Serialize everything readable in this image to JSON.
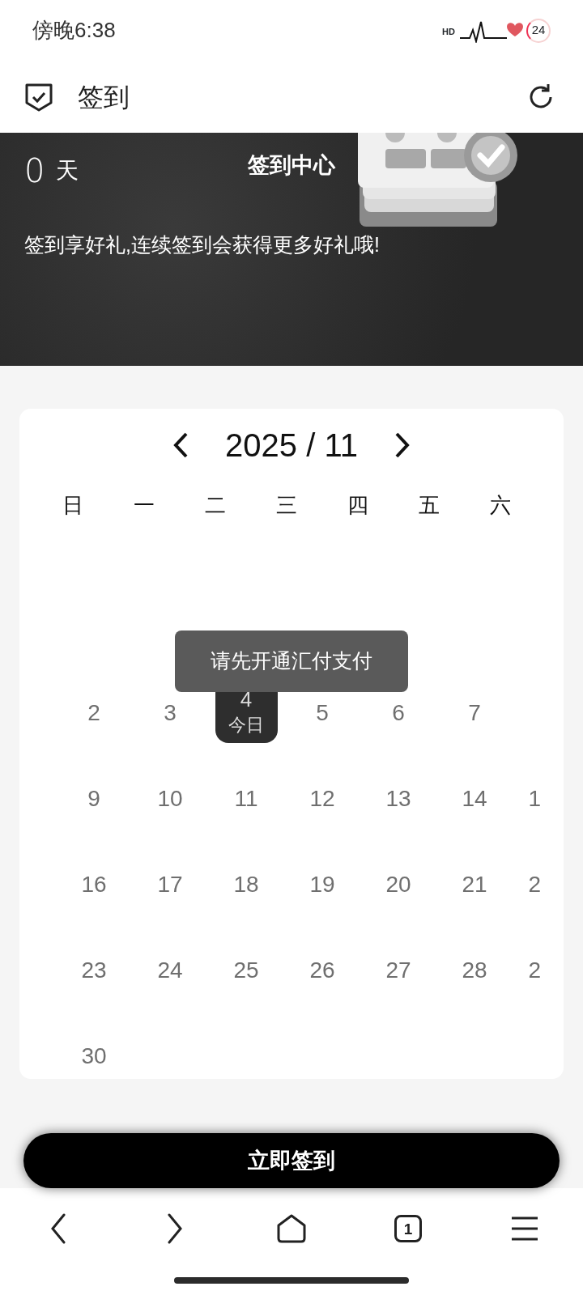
{
  "status_bar": {
    "time": "傍晚6:38",
    "network_label": "HD",
    "battery": "24"
  },
  "app_bar": {
    "title": "签到"
  },
  "banner": {
    "streak_count": "0",
    "streak_unit": "天",
    "title": "签到中心",
    "subtitle": "签到享好礼,连续签到会获得更多好礼哦!"
  },
  "calendar": {
    "month": "2025 / 11",
    "weekdays": [
      "日",
      "一",
      "二",
      "三",
      "四",
      "五",
      "六"
    ],
    "weeks": [
      [
        {
          "day": "2",
          "today": false
        },
        {
          "day": "3",
          "today": false
        },
        {
          "day": "4",
          "today": true,
          "note": "今日"
        },
        {
          "day": "5",
          "today": false
        },
        {
          "day": "6",
          "today": false
        },
        {
          "day": "7",
          "today": false
        }
      ],
      [
        {
          "day": "9",
          "today": false
        },
        {
          "day": "10",
          "today": false
        },
        {
          "day": "11",
          "today": false
        },
        {
          "day": "12",
          "today": false
        },
        {
          "day": "13",
          "today": false
        },
        {
          "day": "14",
          "today": false
        },
        {
          "day": "1",
          "today": false
        }
      ],
      [
        {
          "day": "16",
          "today": false
        },
        {
          "day": "17",
          "today": false
        },
        {
          "day": "18",
          "today": false
        },
        {
          "day": "19",
          "today": false
        },
        {
          "day": "20",
          "today": false
        },
        {
          "day": "21",
          "today": false
        },
        {
          "day": "2",
          "today": false
        }
      ],
      [
        {
          "day": "23",
          "today": false
        },
        {
          "day": "24",
          "today": false
        },
        {
          "day": "25",
          "today": false
        },
        {
          "day": "26",
          "today": false
        },
        {
          "day": "27",
          "today": false
        },
        {
          "day": "28",
          "today": false
        },
        {
          "day": "2",
          "today": false
        }
      ],
      [
        {
          "day": "30",
          "today": false
        }
      ]
    ]
  },
  "toast": {
    "text": "请先开通汇付支付"
  },
  "sign_button": {
    "label": "立即签到"
  },
  "browser_toolbar": {
    "tab_count": "1"
  }
}
